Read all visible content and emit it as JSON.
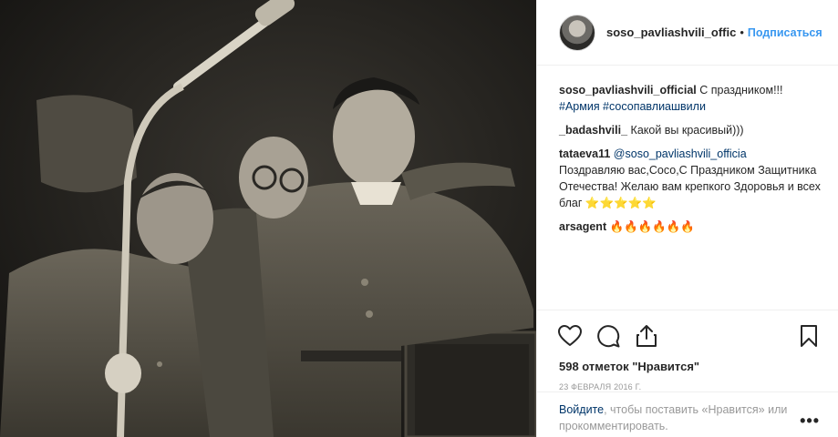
{
  "header": {
    "username": "soso_pavliashvili_offic",
    "separator": "•",
    "follow_label": "Подписаться"
  },
  "caption": {
    "username": "soso_pavliashvili_official",
    "text": "С праздником!!!",
    "hashtags": "#Армия #сосопавлиашвили"
  },
  "comments": [
    {
      "username": "_badashvili_",
      "text": "Какой вы красивый)))"
    },
    {
      "username": "tataeva11",
      "mention": "@soso_pavliashvili_officia",
      "text": "Поздравляю вас,Сосо,С Праздником Защитника Отечества! Желаю вам крепкого Здоровья и всех благ",
      "emoji": "⭐⭐⭐⭐⭐"
    },
    {
      "username": "arsagent",
      "emoji": "🔥🔥🔥🔥🔥🔥"
    }
  ],
  "icons": {
    "like": "heart-icon",
    "comment": "comment-icon",
    "share": "share-icon",
    "save": "bookmark-icon",
    "more": "more-options-icon"
  },
  "likes_text": "598 отметок \"Нравится\"",
  "date_text": "23 ФЕВРАЛЯ 2016 Г.",
  "login_prompt": {
    "login_link": "Войдите",
    "text": ", чтобы поставить «Нравится» или прокомментировать."
  },
  "more_label": "•••",
  "colors": {
    "link_blue": "#3897f0",
    "hashtag": "#003569",
    "text": "#262626",
    "muted": "#999999"
  }
}
